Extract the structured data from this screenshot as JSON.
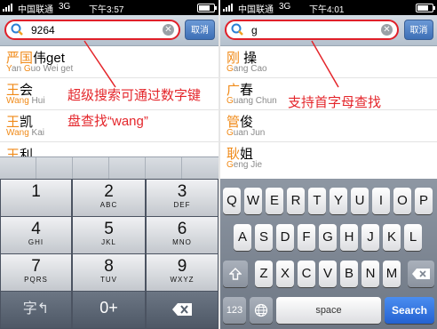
{
  "left": {
    "status": {
      "carrier": "中国联通",
      "network": "3G",
      "time": "下午3:57"
    },
    "search": {
      "query": "9264",
      "cancel_label": "取消"
    },
    "contacts": [
      {
        "hl": "严国",
        "rest": "伟get",
        "pinyin_hl": "Y",
        "pinyin_a": "an ",
        "pinyin_hl2": "G",
        "pinyin_b": "uo Wei get"
      },
      {
        "hl": "王",
        "rest": "会",
        "pinyin_hl": "Wang",
        "pinyin_a": " Hui",
        "pinyin_hl2": "",
        "pinyin_b": ""
      },
      {
        "hl": "王",
        "rest": "凯",
        "pinyin_hl": "Wang",
        "pinyin_a": " Kai",
        "pinyin_hl2": "",
        "pinyin_b": ""
      },
      {
        "hl": "王",
        "rest": "利",
        "pinyin_hl": "",
        "pinyin_a": "",
        "pinyin_hl2": "",
        "pinyin_b": ""
      }
    ],
    "annotation_line1": "超级搜索可通过数字键",
    "annotation_line2": "盘查找“wang”",
    "keypad": [
      {
        "d": "1",
        "l": ""
      },
      {
        "d": "2",
        "l": "ABC"
      },
      {
        "d": "3",
        "l": "DEF"
      },
      {
        "d": "4",
        "l": "GHI"
      },
      {
        "d": "5",
        "l": "JKL"
      },
      {
        "d": "6",
        "l": "MNO"
      },
      {
        "d": "7",
        "l": "PQRS"
      },
      {
        "d": "8",
        "l": "TUV"
      },
      {
        "d": "9",
        "l": "WXYZ"
      }
    ],
    "zero_key": "0+",
    "handwriting_icon": "handwriting-icon",
    "backspace_icon": "backspace-icon"
  },
  "right": {
    "status": {
      "carrier": "中国联通",
      "network": "3G",
      "time": "下午4:01"
    },
    "search": {
      "query": "g",
      "cancel_label": "取消"
    },
    "contacts": [
      {
        "hl": "刚",
        "rest": " 操",
        "pinyin_hl": "G",
        "pinyin_a": "ang Cao"
      },
      {
        "hl": "广",
        "rest": "春",
        "pinyin_hl": "G",
        "pinyin_a": "uang Chun"
      },
      {
        "hl": "管",
        "rest": "俊",
        "pinyin_hl": "G",
        "pinyin_a": "uan Jun"
      },
      {
        "hl": "耿",
        "rest": "姐",
        "pinyin_hl": "G",
        "pinyin_a": "eng Jie"
      }
    ],
    "annotation": "支持首字母查找",
    "keyboard_rows": [
      [
        "Q",
        "W",
        "E",
        "R",
        "T",
        "Y",
        "U",
        "I",
        "O",
        "P"
      ],
      [
        "A",
        "S",
        "D",
        "F",
        "G",
        "H",
        "J",
        "K",
        "L"
      ],
      [
        "Z",
        "X",
        "C",
        "V",
        "B",
        "N",
        "M"
      ]
    ],
    "key_123": "123",
    "key_space": "space",
    "key_search": "Search",
    "globe_icon": "globe-icon",
    "shift_icon": "shift-icon",
    "backspace_icon": "backspace-icon"
  },
  "colors": {
    "highlight": "#f08a18",
    "annotation": "#e4262b",
    "search_blue": "#2462d1"
  }
}
